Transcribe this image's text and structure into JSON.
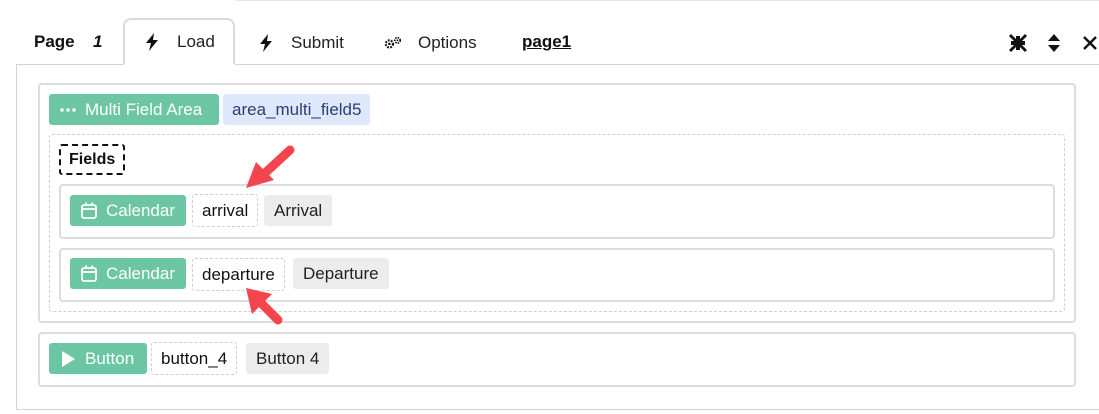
{
  "header": {
    "page_label": "Page",
    "page_number": "1",
    "tabs": [
      {
        "label": "Load",
        "icon": "bolt-icon",
        "active": true
      },
      {
        "label": "Submit",
        "icon": "bolt-icon",
        "active": false
      },
      {
        "label": "Options",
        "icon": "gears-icon",
        "active": false
      }
    ],
    "page_link": "page1",
    "controls": [
      "compress-icon",
      "sort-icon",
      "close-icon"
    ]
  },
  "multi_field_area": {
    "type_label": "Multi Field Area",
    "type_icon": "ellipsis-icon",
    "id": "area_multi_field5",
    "fields_label": "Fields",
    "fields": [
      {
        "type_label": "Calendar",
        "type_icon": "calendar-icon",
        "id": "arrival",
        "label": "Arrival"
      },
      {
        "type_label": "Calendar",
        "type_icon": "calendar-icon",
        "id": "departure",
        "label": "Departure"
      }
    ]
  },
  "button_block": {
    "type_label": "Button",
    "type_icon": "play-icon",
    "id": "button_4",
    "label": "Button 4"
  },
  "colors": {
    "chip_green": "#6cc6a4",
    "chip_blue_bg": "#dde9fb",
    "chip_blue_text": "#2c3e73",
    "chip_label_bg": "#ececec",
    "annotation_arrow": "#f4444e"
  }
}
